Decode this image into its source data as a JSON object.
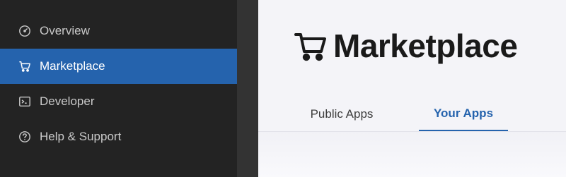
{
  "sidebar": {
    "items": [
      {
        "label": "Overview",
        "icon": "gauge-icon"
      },
      {
        "label": "Marketplace",
        "icon": "cart-icon",
        "active": true
      },
      {
        "label": "Developer",
        "icon": "terminal-icon"
      },
      {
        "label": "Help & Support",
        "icon": "help-circle-icon"
      }
    ]
  },
  "main": {
    "title": "Marketplace",
    "title_icon": "cart-icon",
    "tabs": [
      {
        "label": "Public Apps",
        "active": false
      },
      {
        "label": "Your Apps",
        "active": true
      }
    ]
  },
  "colors": {
    "sidebar_bg": "#232323",
    "accent": "#2563ad",
    "main_bg": "#f4f4f8"
  }
}
